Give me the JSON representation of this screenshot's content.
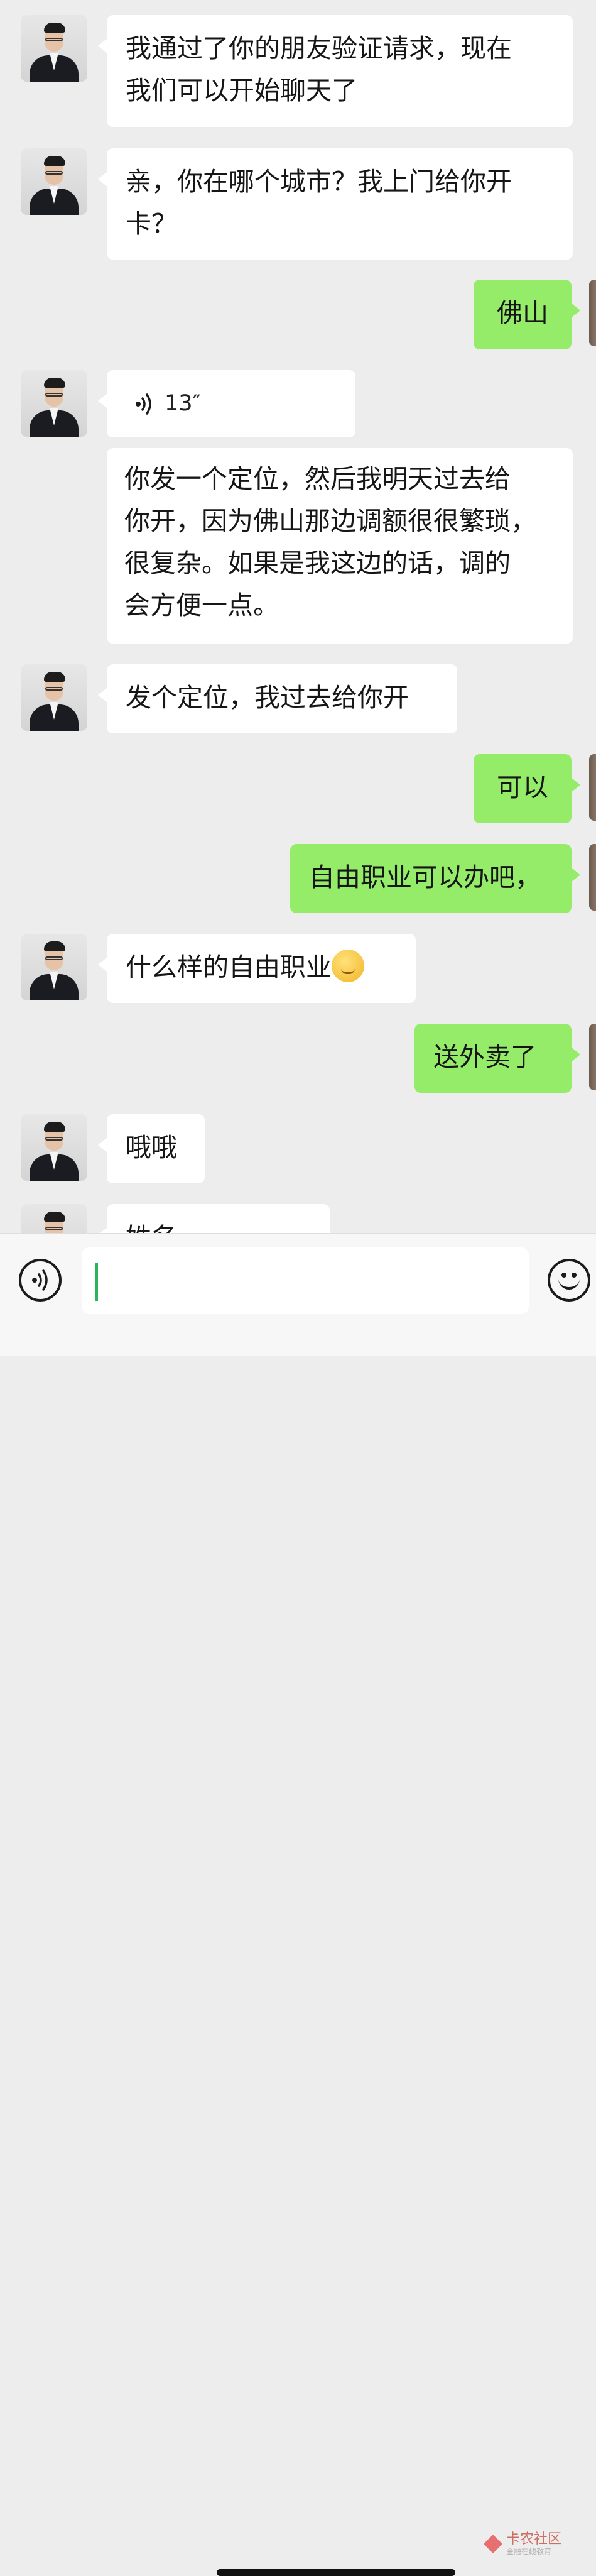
{
  "messages": [
    {
      "side": "in",
      "text": "我通过了你的朋友验证请求，现在\n我们可以开始聊天了"
    },
    {
      "side": "in",
      "text": "亲，你在哪个城市？我上门给你开\n卡？"
    },
    {
      "side": "out",
      "text": "佛山"
    },
    {
      "side": "in",
      "type": "voice",
      "duration": "13″"
    },
    {
      "side": "in",
      "text": "你发一个定位，然后我明天过去给\n你开，因为佛山那边调额很很繁琐，\n很复杂。如果是我这边的话，调的\n会方便一点。"
    },
    {
      "side": "in",
      "text": "发个定位，我过去给你开"
    },
    {
      "side": "out",
      "text": "可以"
    },
    {
      "side": "out",
      "text": "自由职业可以办吧，"
    },
    {
      "side": "in",
      "text": "什么样的自由职业",
      "emoji": "thinking-face"
    },
    {
      "side": "out",
      "text": "送外卖了"
    },
    {
      "side": "in",
      "text": "哦哦"
    },
    {
      "side": "in",
      "text": "姓名"
    }
  ],
  "input": {
    "value": "",
    "placeholder": ""
  },
  "watermark": {
    "title": "卡农社区",
    "subtitle": "金融在线教育"
  },
  "colors": {
    "background": "#ededed",
    "incoming": "#ffffff",
    "outgoing": "#95ec69",
    "caret": "#2bb45a"
  }
}
